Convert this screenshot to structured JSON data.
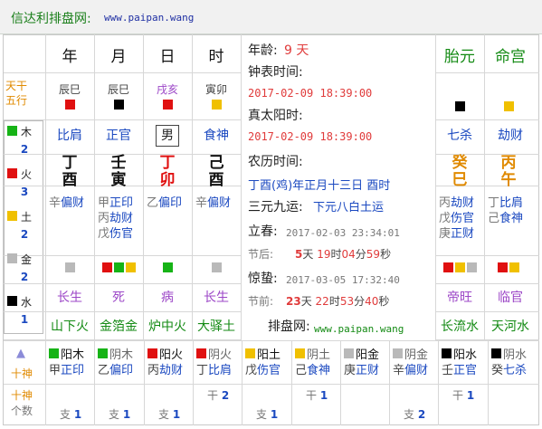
{
  "header": {
    "site_title": "信达利排盘网:",
    "site_url": "www.paipan.wang"
  },
  "columns": {
    "year": "年",
    "month": "月",
    "day": "日",
    "hour": "时",
    "tai": "胎元",
    "ming": "命宫"
  },
  "left_labels": {
    "tiangan": "天干",
    "wuxing": "五行",
    "shishen": "十神",
    "geshu": "个数"
  },
  "elements": [
    {
      "name": "木",
      "count": "2",
      "color": "#16b316"
    },
    {
      "name": "火",
      "count": "3",
      "color": "#e01010"
    },
    {
      "name": "土",
      "count": "2",
      "color": "#f0c000"
    },
    {
      "name": "金",
      "count": "2",
      "color": "#b9b9b9"
    },
    {
      "name": "水",
      "count": "1",
      "color": "#000000"
    }
  ],
  "pillars": {
    "wuxing_row": [
      "辰巳",
      "辰巳",
      "戌亥",
      "寅卯"
    ],
    "wuxing_sq": [
      "#e01010",
      "#000000",
      "#e01010",
      "#f0c000"
    ],
    "shen_row": [
      "比肩",
      "正官",
      "男",
      "食神"
    ],
    "stem": [
      "丁",
      "壬",
      "丁",
      "己"
    ],
    "branch": [
      "酉",
      "寅",
      "卯",
      "酉"
    ],
    "hidden": [
      [
        [
          "辛",
          "偏财"
        ]
      ],
      [
        [
          "甲",
          "正印"
        ],
        [
          "丙",
          "劫财"
        ],
        [
          "戊",
          "伤官"
        ]
      ],
      [
        [
          "乙",
          "偏印"
        ]
      ],
      [
        [
          "辛",
          "偏财"
        ]
      ]
    ],
    "phase": [
      "长生",
      "死",
      "病",
      "长生"
    ],
    "nayin": [
      "山下火",
      "金箔金",
      "炉中火",
      "大驿土"
    ]
  },
  "tai": {
    "wuxing_sq": "#000000",
    "shen": "七杀",
    "stem": "癸",
    "branch": "巳",
    "hidden": [
      [
        "丙",
        "劫财"
      ],
      [
        "戊",
        "伤官"
      ],
      [
        "庚",
        "正财"
      ]
    ],
    "phase": "帝旺",
    "nayin": "长流水"
  },
  "ming": {
    "wuxing_sq": "#f0c000",
    "shen": "劫财",
    "stem": "丙",
    "branch": "午",
    "hidden": [
      [
        "丁",
        "比肩"
      ],
      [
        "己",
        "食神"
      ]
    ],
    "phase": "临官",
    "nayin": "天河水"
  },
  "info": {
    "age_label": "年龄:",
    "age_value": "9 天",
    "clock_label": "钟表时间:",
    "clock_value": "2017-02-09 18:39:00",
    "solar_label": "真太阳时:",
    "solar_value": "2017-02-09 18:39:00",
    "lunar_label": "农历时间:",
    "lunar_value": "丁酉(鸡)年正月十三日 酉时",
    "sanyuan_label": "三元九运:",
    "sanyuan_value": "下元八白土运",
    "lichun_label": "立春:",
    "lichun_value": "2017-02-03 23:34:01",
    "jiehou_label": "节后:",
    "jiehou_value": "5天 19时04分59秒",
    "jingzhe_label": "惊蛰:",
    "jingzhe_value": "2017-03-05 17:32:40",
    "jieqian_label": "节前:",
    "jieqian_value": "23天 22时53分40秒",
    "paipan_label": "排盘网:",
    "paipan_url": "www.paipan.wang"
  },
  "bottom_shishen": [
    {
      "sq": "#16b316",
      "name": "阳木",
      "a": "甲",
      "b": "正印"
    },
    {
      "sq": "#16b316",
      "name": "阴木",
      "a": "乙",
      "b": "偏印"
    },
    {
      "sq": "#e01010",
      "name": "阳火",
      "a": "丙",
      "b": "劫财"
    },
    {
      "sq": "#e01010",
      "name": "阴火",
      "a": "丁",
      "b": "比肩"
    },
    {
      "sq": "#f0c000",
      "name": "阳土",
      "a": "戊",
      "b": "伤官"
    },
    {
      "sq": "#f0c000",
      "name": "阴土",
      "a": "己",
      "b": "食神"
    },
    {
      "sq": "#b9b9b9",
      "name": "阳金",
      "a": "庚",
      "b": "正财"
    },
    {
      "sq": "#b9b9b9",
      "name": "阴金",
      "a": "辛",
      "b": "偏财"
    },
    {
      "sq": "#000000",
      "name": "阳水",
      "a": "壬",
      "b": "正官"
    },
    {
      "sq": "#000000",
      "name": "阴水",
      "a": "癸",
      "b": "七杀"
    }
  ],
  "bottom_counts": [
    {
      "gan": "",
      "zhi": "支 1"
    },
    {
      "gan": "",
      "zhi": "支 1"
    },
    {
      "gan": "",
      "zhi": "支 1"
    },
    {
      "gan": "干 2",
      "zhi": ""
    },
    {
      "gan": "",
      "zhi": "支 1"
    },
    {
      "gan": "干 1",
      "zhi": ""
    },
    {
      "gan": "",
      "zhi": ""
    },
    {
      "gan": "",
      "zhi": "支 2"
    },
    {
      "gan": "干 1",
      "zhi": ""
    },
    {
      "gan": "",
      "zhi": ""
    }
  ],
  "bottom_arrow": "▲"
}
